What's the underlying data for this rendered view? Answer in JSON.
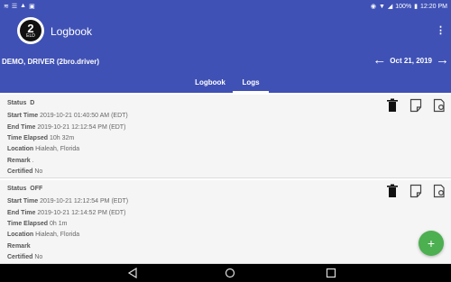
{
  "status_bar": {
    "battery": "100%",
    "time": "12:20 PM"
  },
  "app": {
    "title": "Logbook",
    "logo_text": "2",
    "logo_subtext": "ELD"
  },
  "driver_bar": {
    "driver_name": "DEMO, DRIVER (2bro.driver)",
    "date": "Oct 21, 2019"
  },
  "tabs": [
    {
      "label": "Logbook",
      "active": false
    },
    {
      "label": "Logs",
      "active": true
    }
  ],
  "labels": {
    "status": "Status",
    "start_time": "Start Time",
    "end_time": "End Time",
    "time_elapsed": "Time Elapsed",
    "location": "Location",
    "remark": "Remark",
    "certified": "Certified"
  },
  "logs": [
    {
      "status": "D",
      "start_time": "2019-10-21 01:40:50 AM (EDT)",
      "end_time": "2019-10-21 12:12:54 PM (EDT)",
      "time_elapsed": "10h 32m",
      "location": "Hialeah, Florida",
      "remark": ".",
      "certified": "No"
    },
    {
      "status": "OFF",
      "start_time": "2019-10-21 12:12:54 PM (EDT)",
      "end_time": "2019-10-21 12:14:52 PM (EDT)",
      "time_elapsed": "0h 1m",
      "location": "Hialeah, Florida",
      "remark": "",
      "certified": "No"
    }
  ],
  "fab": {
    "label": "+"
  },
  "colors": {
    "primary": "#3f51b5",
    "fab": "#4caf50",
    "card_bg": "#f5f5f5"
  },
  "icons": {
    "actions": [
      "trash-icon",
      "edit-note-icon",
      "annotate-icon"
    ],
    "nav": [
      "back-icon",
      "home-icon",
      "recents-icon"
    ]
  }
}
